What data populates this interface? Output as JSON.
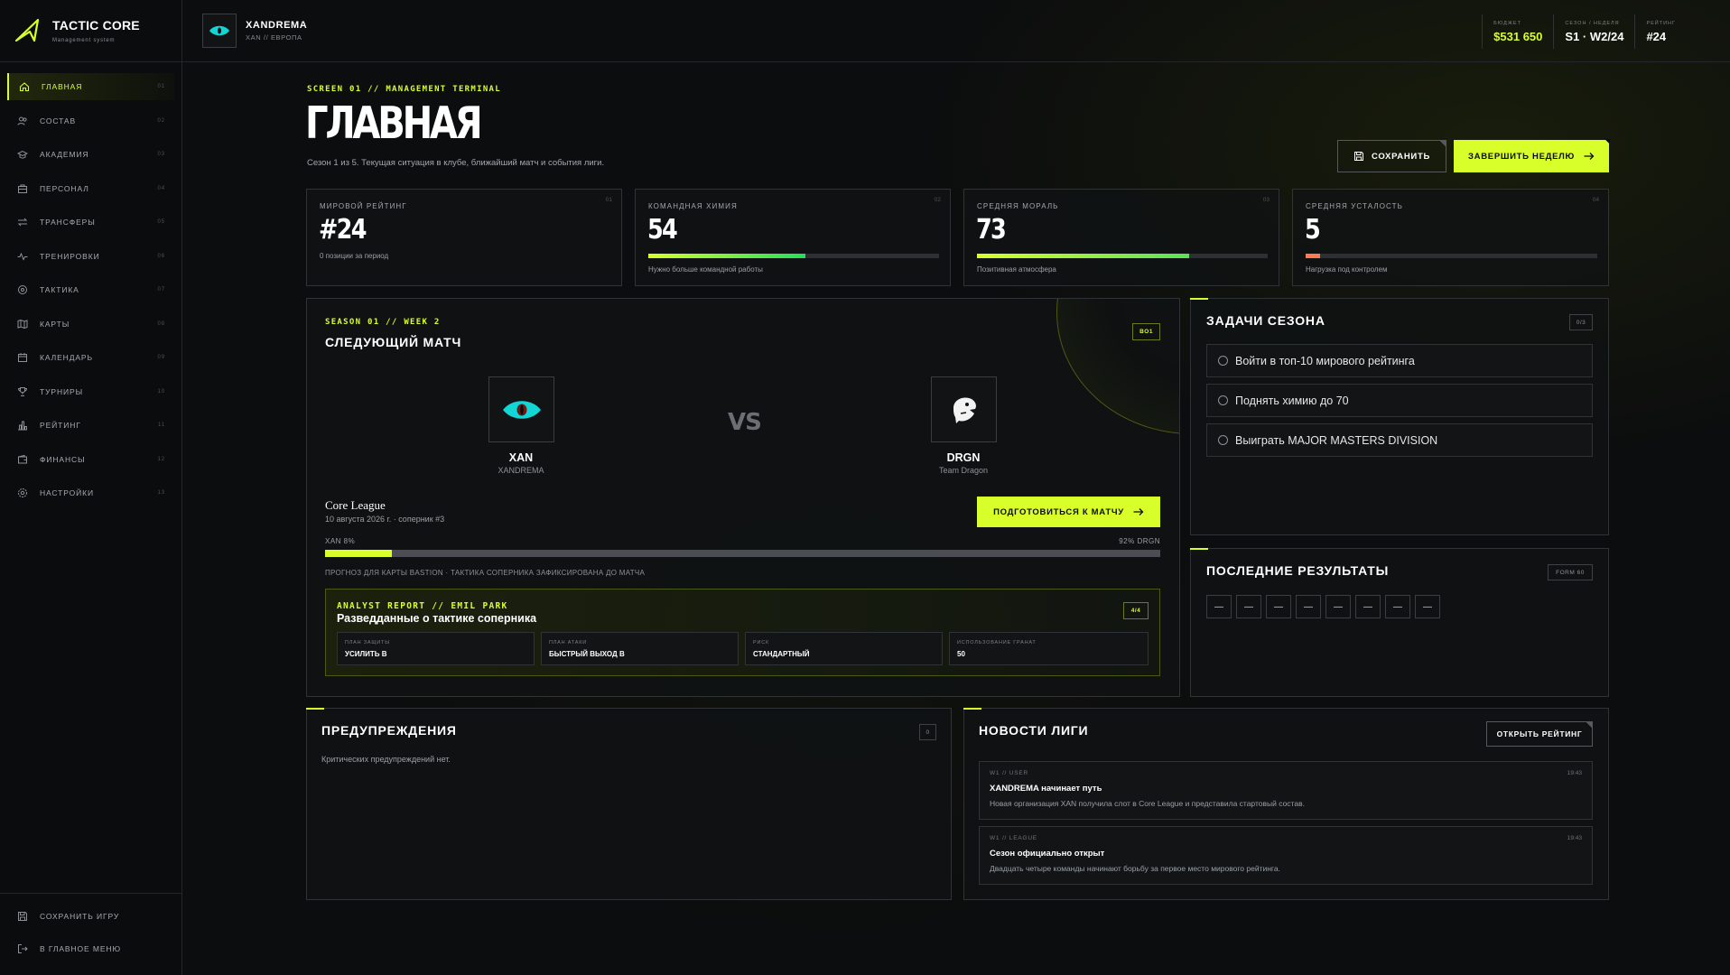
{
  "app": {
    "name": "TACTIC CORE",
    "subtitle": "Management system"
  },
  "header": {
    "team_name": "XANDREMA",
    "team_sub": "XAN // ЕВРОПА",
    "stats": [
      {
        "label": "БЮДЖЕТ",
        "value": "$531 650"
      },
      {
        "label": "СЕЗОН / НЕДЕЛЯ",
        "value": "S1 · W2/24"
      },
      {
        "label": "РЕЙТИНГ",
        "value": "#24"
      }
    ]
  },
  "sidebar": {
    "items": [
      {
        "label": "ГЛАВНАЯ",
        "num": "01",
        "icon": "home-icon"
      },
      {
        "label": "СОСТАВ",
        "num": "02",
        "icon": "users-icon"
      },
      {
        "label": "АКАДЕМИЯ",
        "num": "03",
        "icon": "graduation-cap-icon"
      },
      {
        "label": "ПЕРСОНАЛ",
        "num": "04",
        "icon": "briefcase-icon"
      },
      {
        "label": "ТРАНСФЕРЫ",
        "num": "05",
        "icon": "swap-arrows-icon"
      },
      {
        "label": "ТРЕНИРОВКИ",
        "num": "06",
        "icon": "activity-icon"
      },
      {
        "label": "ТАКТИКА",
        "num": "07",
        "icon": "target-icon"
      },
      {
        "label": "КАРТЫ",
        "num": "08",
        "icon": "map-icon"
      },
      {
        "label": "КАЛЕНДАРЬ",
        "num": "09",
        "icon": "calendar-icon"
      },
      {
        "label": "ТУРНИРЫ",
        "num": "10",
        "icon": "trophy-icon"
      },
      {
        "label": "РЕЙТИНГ",
        "num": "11",
        "icon": "bar-chart-icon"
      },
      {
        "label": "ФИНАНСЫ",
        "num": "12",
        "icon": "wallet-icon"
      },
      {
        "label": "НАСТРОЙКИ",
        "num": "13",
        "icon": "gear-icon"
      }
    ],
    "bottom": [
      {
        "label": "СОХРАНИТЬ ИГРУ",
        "icon": "save-icon"
      },
      {
        "label": "В ГЛАВНОЕ МЕНЮ",
        "icon": "logout-icon"
      }
    ]
  },
  "page": {
    "eyebrow": "SCREEN 01 // MANAGEMENT TERMINAL",
    "title": "ГЛАВНАЯ",
    "subtitle": "Сезон 1 из 5. Текущая ситуация в клубе, ближайший матч и события лиги.",
    "save_label": "СОХРАНИТЬ",
    "finish_week_label": "ЗАВЕРШИТЬ НЕДЕЛЮ"
  },
  "kpis": [
    {
      "label": "МИРОВОЙ РЕЙТИНГ",
      "num": "01",
      "value": "#24",
      "caption": "0 позиции за период"
    },
    {
      "label": "КОМАНДНАЯ ХИМИЯ",
      "num": "02",
      "value": "54",
      "caption": "Нужно больше командной работы",
      "level": 0.54,
      "color": "#22e05a"
    },
    {
      "label": "СРЕДНЯЯ МОРАЛЬ",
      "num": "03",
      "value": "73",
      "caption": "Позитивная атмосфера",
      "level": 0.73,
      "color": "#86e84a"
    },
    {
      "label": "СРЕДНЯЯ УСТАЛОСТЬ",
      "num": "04",
      "value": "5",
      "caption": "Нагрузка под контролем",
      "level": 0.05,
      "color": "#ff7a52"
    }
  ],
  "match": {
    "eyebrow": "SEASON 01 // WEEK 2",
    "title": "СЛЕДУЮЩИЙ МАТЧ",
    "format": "BO1",
    "vs": "VS",
    "home": {
      "tag": "XAN",
      "name": "XANDREMA"
    },
    "away": {
      "tag": "DRGN",
      "name": "Team Dragon"
    },
    "league": "Core League",
    "info": "10 августа 2026 г. · соперник #3",
    "prepare_label": "ПОДГОТОВИТЬСЯ К МАТЧУ",
    "home_chance_label": "XAN 8%",
    "away_chance_label": "92% DRGN",
    "home_chance": 0.08,
    "forecast": "ПРОГНОЗ ДЛЯ КАРТЫ BASTION · ТАКТИКА СОПЕРНИКА ЗАФИКСИРОВАНА ДО МАТЧА",
    "analyst": {
      "eyebrow": "ANALYST REPORT // EMIL PARK",
      "title": "Разведданные о тактике соперника",
      "badge": "4/4",
      "fields": [
        {
          "label": "ПЛАН ЗАЩИТЫ",
          "value": "УСИЛИТЬ B"
        },
        {
          "label": "ПЛАН АТАКИ",
          "value": "БЫСТРЫЙ ВЫХОД B"
        },
        {
          "label": "РИСК",
          "value": "СТАНДАРТНЫЙ"
        },
        {
          "label": "ИСПОЛЬЗОВАНИЕ ГРАНАТ",
          "value": "50"
        }
      ]
    }
  },
  "tasks": {
    "title": "ЗАДАЧИ СЕЗОНА",
    "badge": "0/3",
    "items": [
      "Войти в топ-10 мирового рейтинга",
      "Поднять химию до 70",
      "Выиграть MAJOR MASTERS DIVISION"
    ]
  },
  "results": {
    "title": "ПОСЛЕДНИЕ РЕЗУЛЬТАТЫ",
    "badge": "FORM 60",
    "items": [
      "—",
      "—",
      "—",
      "—",
      "—",
      "—",
      "—",
      "—"
    ]
  },
  "warnings": {
    "title": "ПРЕДУПРЕЖДЕНИЯ",
    "badge": "0",
    "empty_text": "Критических предупреждений нет."
  },
  "news": {
    "title": "НОВОСТИ ЛИГИ",
    "open_label": "ОТКРЫТЬ РЕЙТИНГ",
    "items": [
      {
        "meta": "W1 // USER",
        "time": "19:43",
        "title": "XANDREMA начинает путь",
        "desc": "Новая организация XAN получила слот в Core League и представила стартовый состав."
      },
      {
        "meta": "W1 // LEAGUE",
        "time": "19:43",
        "title": "Сезон официально открыт",
        "desc": "Двадцать четыре команды начинают борьбу за первое место мирового рейтинга."
      }
    ]
  },
  "colors": {
    "accent": "#d8ff2a",
    "background": "#0c0d0e",
    "home_logo": "#12d6d6"
  }
}
